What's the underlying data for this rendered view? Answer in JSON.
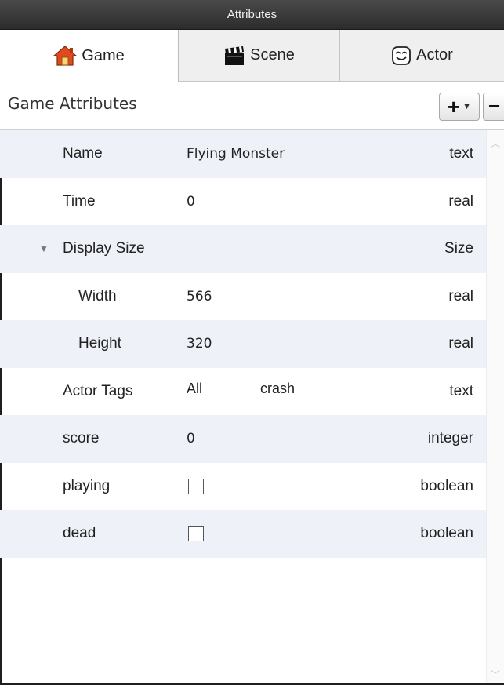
{
  "window": {
    "title": "Attributes"
  },
  "tabs": [
    {
      "label": "Game",
      "icon": "house-icon",
      "active": true
    },
    {
      "label": "Scene",
      "icon": "clapperboard-icon",
      "active": false
    },
    {
      "label": "Actor",
      "icon": "mask-icon",
      "active": false
    }
  ],
  "header": {
    "title": "Game Attributes",
    "add_label": "+",
    "remove_label": "−"
  },
  "attributes": [
    {
      "name": "Name",
      "value": "Flying Monster",
      "type": "text"
    },
    {
      "name": "Time",
      "value": "0",
      "type": "real"
    },
    {
      "name": "Display Size",
      "type": "Size",
      "expanded": true
    },
    {
      "name": "Width",
      "value": "566",
      "type": "real"
    },
    {
      "name": "Height",
      "value": "320",
      "type": "real"
    },
    {
      "name": "Actor Tags",
      "tags": [
        "All",
        "crash"
      ],
      "type": "text"
    },
    {
      "name": "score",
      "value": "0",
      "type": "integer"
    },
    {
      "name": "playing",
      "checked": false,
      "type": "boolean"
    },
    {
      "name": "dead",
      "checked": false,
      "type": "boolean"
    }
  ],
  "colors": {
    "row_alt": "#eef1f7",
    "titlebar": "#3a3a3a"
  }
}
